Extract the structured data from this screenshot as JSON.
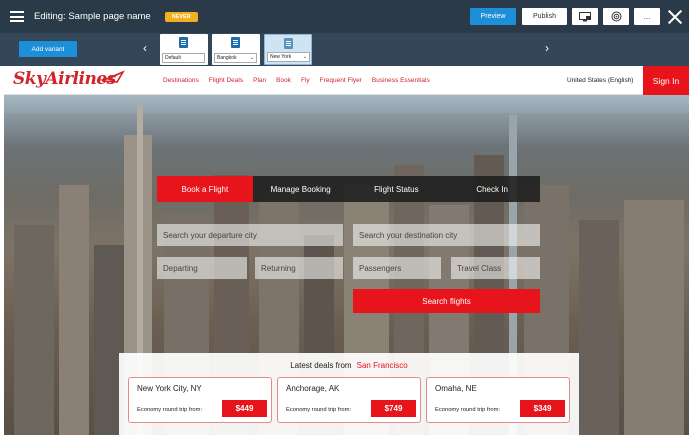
{
  "editor": {
    "title": "Editing: Sample page name",
    "badge": "NEVER",
    "preview_label": "Preview",
    "publish_label": "Publish",
    "more_label": "...",
    "icons": [
      "menu-icon",
      "monitor-icon",
      "target-icon",
      "close-icon"
    ]
  },
  "variants": {
    "add_label": "Add variant",
    "items": [
      {
        "label": "Default",
        "active": false
      },
      {
        "label": "Bangkok",
        "active": false
      },
      {
        "label": "New York",
        "active": true
      }
    ]
  },
  "site": {
    "logo": "SkyAirlines",
    "nav": [
      "Destinations",
      "Flight Deals",
      "Plan",
      "Book",
      "Fly",
      "Frequent Flyer",
      "Business Essentials"
    ],
    "locale": "United States (English)",
    "sign_in": "Sign In"
  },
  "booking": {
    "tabs": [
      "Book a Flight",
      "Manage Booking",
      "Flight Status",
      "Check In"
    ],
    "active_tab": 0,
    "departure_placeholder": "Search your departure city",
    "destination_placeholder": "Search your destination city",
    "departing": "Departing",
    "returning": "Returning",
    "passengers": "Passengers",
    "travel_class": "Travel Class",
    "search_label": "Search flights"
  },
  "deals": {
    "title": "Latest deals from",
    "origin": "San Francisco",
    "items": [
      {
        "city": "New York City, NY",
        "label": "Economy round trip from:",
        "price": "$449"
      },
      {
        "city": "Anchorage, AK",
        "label": "Economy round trip from:",
        "price": "$749"
      },
      {
        "city": "Omaha, NE",
        "label": "Economy round trip from:",
        "price": "$349"
      }
    ]
  },
  "colors": {
    "editor_bg": "#2b3a48",
    "variant_bg": "#34475a",
    "accent_blue": "#1d8ed8",
    "brand_red": "#e8141b",
    "badge_yellow": "#f2b01e"
  }
}
